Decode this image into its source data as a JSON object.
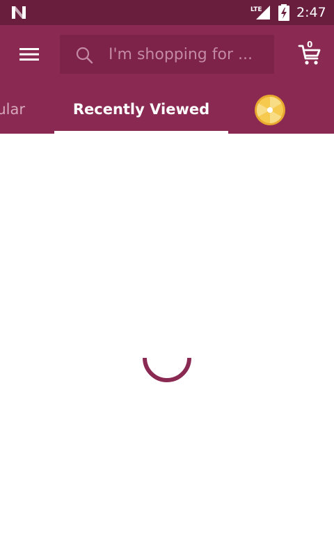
{
  "status_bar": {
    "time": "2:47",
    "notification_icon": "n-logo-icon",
    "signal_icon": "lte-signal-icon",
    "battery_icon": "battery-charging-icon",
    "lte_label": "LTE"
  },
  "header": {
    "menu_icon": "hamburger-menu-icon",
    "search": {
      "placeholder": "I'm shopping for ...",
      "icon": "search-icon"
    },
    "cart": {
      "icon": "cart-icon",
      "count": "0"
    }
  },
  "tabs": [
    {
      "label": "Popular",
      "visible_label": "pular",
      "active": false
    },
    {
      "label": "Recently Viewed",
      "active": true
    },
    {
      "label": "",
      "icon": "prize-wheel-icon",
      "active": false
    }
  ],
  "main": {
    "state": "loading",
    "spinner_icon": "loading-spinner-icon"
  },
  "colors": {
    "status_bar": "#691e3e",
    "app_bar": "#8a2a53",
    "search_bg": "#7d2249",
    "accent": "#8a2a53",
    "wheel": "#f0b93a"
  }
}
